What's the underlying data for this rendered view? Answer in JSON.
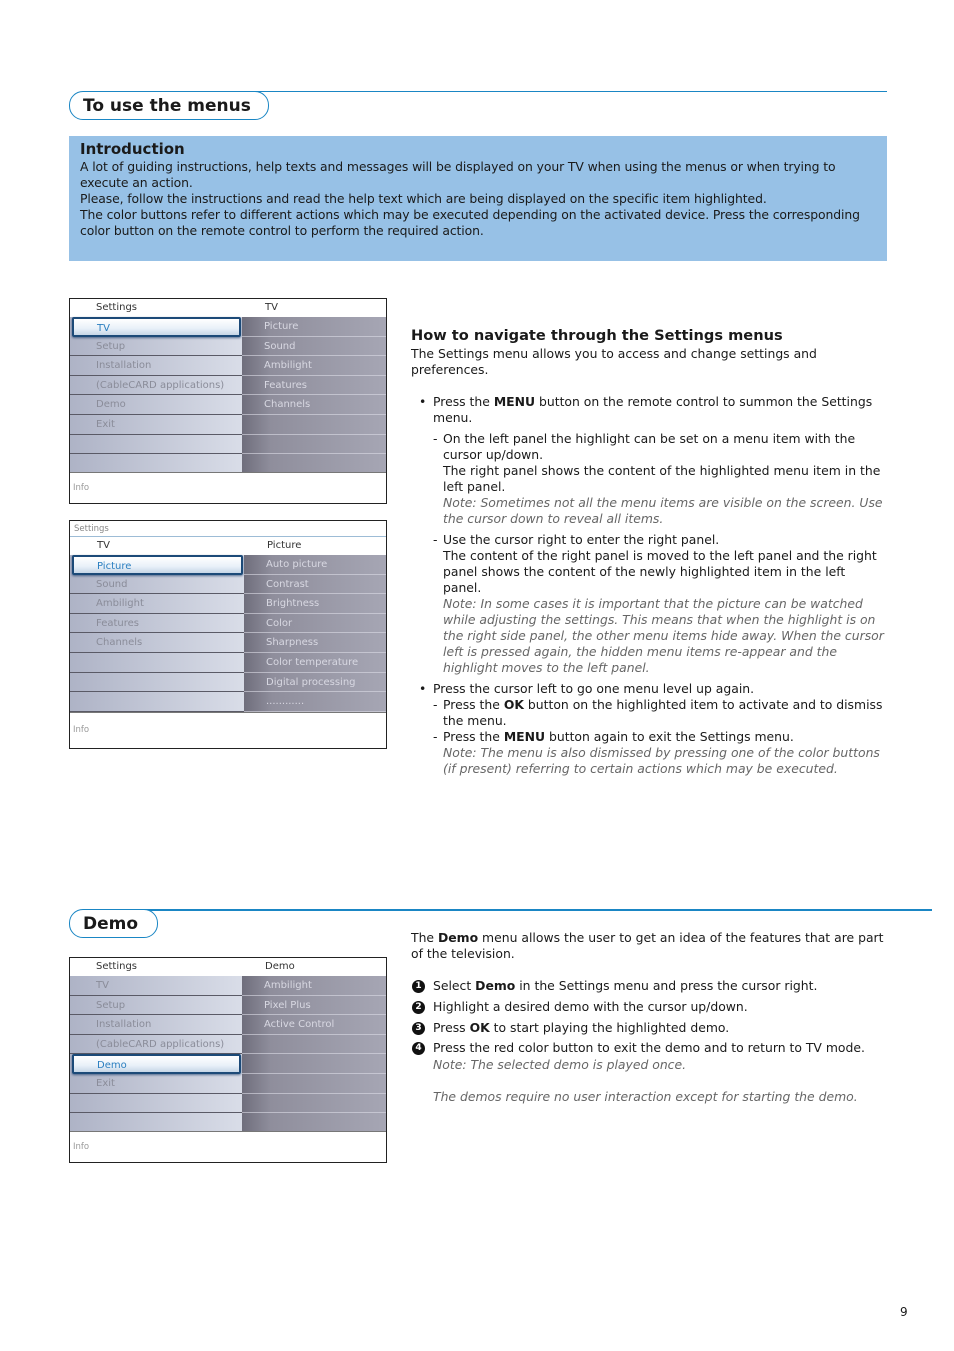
{
  "section1": {
    "title": "To use the menus",
    "intro": {
      "heading": "Introduction",
      "paragraphs": [
        "A lot of guiding instructions, help texts and messages will be displayed on your TV when using the menus or when trying to execute an action.",
        "Please, follow the instructions and read the help text which are being displayed on the specific item highlighted.",
        "The color buttons refer to different actions which may be executed depending on the activated device. Press the corresponding color button on the remote control to perform the required action."
      ]
    },
    "menu1": {
      "left_title": "Settings",
      "right_title": "TV",
      "left_items": [
        "TV",
        "Setup",
        "Installation",
        "(CableCARD applications)",
        "Demo",
        "Exit",
        "",
        ""
      ],
      "selected_index": 0,
      "right_items": [
        "Picture",
        "Sound",
        "Ambilight",
        "Features",
        "Channels",
        "",
        "",
        ""
      ],
      "info": "Info"
    },
    "menu2": {
      "caption": "Settings",
      "left_title": "TV",
      "right_title": "Picture",
      "left_items": [
        "Picture",
        "Sound",
        "Ambilight",
        "Features",
        "Channels",
        "",
        "",
        ""
      ],
      "selected_index": 0,
      "right_items": [
        "Auto picture",
        "Contrast",
        "Brightness",
        "Color",
        "Sharpness",
        "Color temperature",
        "Digital processing",
        "............"
      ],
      "info": "Info"
    },
    "nav": {
      "heading": "How to navigate through the Settings menus",
      "lead": "The Settings menu allows you to access and change settings and preferences.",
      "b1_pre": "Press the ",
      "b1_bold": "MENU",
      "b1_post": " button on the remote control to summon the Settings menu.",
      "d1": "On the left panel the highlight can be set on a menu item with the cursor up/down.",
      "d1b": "The right panel shows the content of the highlighted menu item in the left panel.",
      "d1_note": "Note: Sometimes not all the menu items are visible on the screen. Use the cursor down to reveal all items.",
      "d2": "Use the cursor right to enter the right panel.",
      "d2b": "The content of the right panel is moved to the left panel and the right panel shows the content of the newly highlighted item in the left panel.",
      "d2_note": "Note: In some cases it is important that the picture can be watched while adjusting the settings. This means that when the highlight is on the right side panel, the other menu items hide away. When the cursor left is pressed again, the hidden menu items re-appear and the highlight moves to the left panel.",
      "b2": "Press the cursor left to go one menu level up again.",
      "d3_pre": "Press the ",
      "d3_bold": "OK",
      "d3_post": " button on the highlighted item to activate and to dismiss the menu.",
      "d4_pre": "Press the ",
      "d4_bold": "MENU",
      "d4_post": " button again to exit the Settings menu.",
      "d4_note": "Note: The menu is also dismissed by pressing one of the color buttons (if present) referring to certain actions which may be executed."
    }
  },
  "section2": {
    "title": "Demo",
    "menu": {
      "left_title": "Settings",
      "right_title": "Demo",
      "left_items": [
        "TV",
        "Setup",
        "Installation",
        "(CableCARD applications)",
        "Demo",
        "Exit",
        "",
        ""
      ],
      "selected_index": 4,
      "right_items": [
        "Ambilight",
        "Pixel Plus",
        "Active Control",
        "",
        "",
        "",
        "",
        ""
      ],
      "info": "Info"
    },
    "lead_pre": "The ",
    "lead_bold": "Demo",
    "lead_post": " menu allows the user to get an idea of the features that are part of the television.",
    "steps": [
      {
        "n": "1",
        "pre": "Select ",
        "bold": "Demo",
        "post": " in the Settings menu and press the cursor right."
      },
      {
        "n": "2",
        "pre": "Highlight a desired demo with the cursor up/down.",
        "bold": "",
        "post": ""
      },
      {
        "n": "3",
        "pre": "Press ",
        "bold": "OK",
        "post": " to start playing the highlighted demo."
      },
      {
        "n": "4",
        "pre": "Press the red color button to exit the demo and to return to TV mode.",
        "bold": "",
        "post": ""
      }
    ],
    "note1": "Note: The selected demo is played once.",
    "note2": "The demos require no user interaction except for starting the demo."
  },
  "page_number": "9",
  "colors": {
    "accent": "#1a86c4",
    "intro_bg": "#97c1e6",
    "highlight_text": "#2b7fc0"
  }
}
